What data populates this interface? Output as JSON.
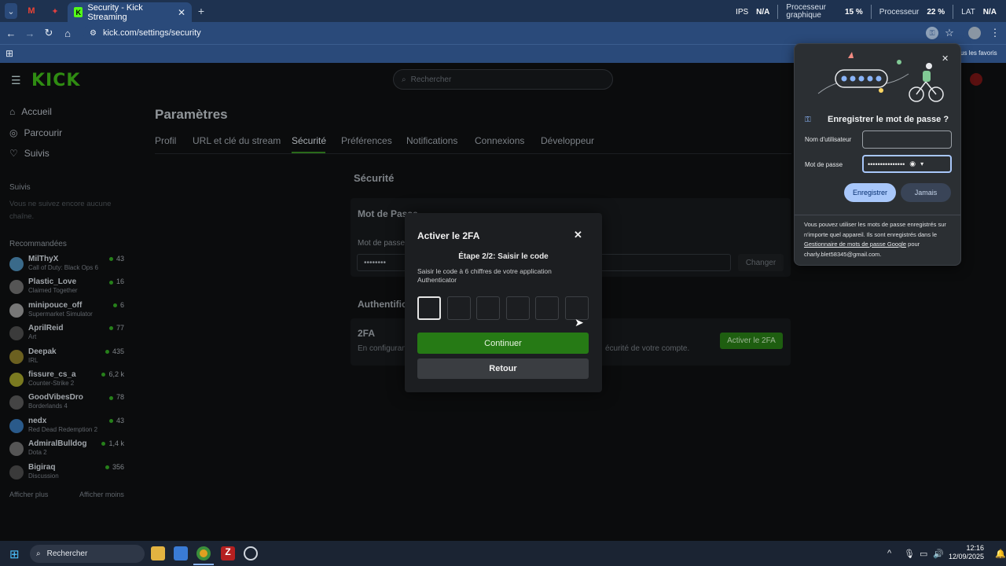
{
  "browser": {
    "tab_title": "Security - Kick Streaming",
    "new_tab": "+",
    "url": "kick.com/settings/security",
    "bookmarks_tail": "us les favoris"
  },
  "sysmon": {
    "ips_label": "IPS",
    "ips_value": "N/A",
    "gpu_label1": "Processeur",
    "gpu_label2": "graphique",
    "gpu_value": "15 %",
    "cpu_label": "Processeur",
    "cpu_value": "22 %",
    "lat_label": "LAT",
    "lat_value": "N/A"
  },
  "site": {
    "logo": "KICK",
    "search_placeholder": "Rechercher",
    "nav": [
      {
        "icon": "home-icon",
        "label": "Accueil"
      },
      {
        "icon": "compass-icon",
        "label": "Parcourir"
      },
      {
        "icon": "heart-icon",
        "label": "Suivis"
      }
    ],
    "following_title": "Suivis",
    "following_empty": "Vous ne suivez encore aucune chaîne.",
    "recommended_title": "Recommandées",
    "streams": [
      {
        "name": "MilThyX",
        "game": "Call of Duty: Black Ops 6",
        "viewers": "43",
        "color": "#3a6a8a"
      },
      {
        "name": "Plastic_Love",
        "game": "Claimed Together",
        "viewers": "16",
        "color": "#555"
      },
      {
        "name": "minipouce_off",
        "game": "Supermarket Simulator",
        "viewers": "6",
        "color": "#777"
      },
      {
        "name": "AprilReid",
        "game": "Art",
        "viewers": "77",
        "color": "#3b3b3b"
      },
      {
        "name": "Deepak",
        "game": "IRL",
        "viewers": "435",
        "color": "#6b6020"
      },
      {
        "name": "fissure_cs_a",
        "game": "Counter-Strike 2",
        "viewers": "6,2 k",
        "color": "#7a7a20"
      },
      {
        "name": "GoodVibesDro",
        "game": "Borderlands 4",
        "viewers": "78",
        "color": "#444"
      },
      {
        "name": "nedx",
        "game": "Red Dead Redemption 2",
        "viewers": "43",
        "color": "#2a5a8a"
      },
      {
        "name": "AdmiralBulldog",
        "game": "Dota 2",
        "viewers": "1,4 k",
        "color": "#555"
      },
      {
        "name": "Bigiraq",
        "game": "Discussion",
        "viewers": "356",
        "color": "#3a3a3a"
      }
    ],
    "show_more": "Afficher plus",
    "show_less": "Afficher moins"
  },
  "settings": {
    "title": "Paramètres",
    "tabs": [
      "Profil",
      "URL et clé du stream",
      "Sécurité",
      "Préférences",
      "Notifications",
      "Connexions",
      "Développeur"
    ],
    "section": "Sécurité",
    "password_card_title": "Mot de Passe",
    "password_label": "Mot de passe",
    "password_value": "••••••••",
    "change_button": "Changer",
    "auth_title": "Authentification",
    "twofa_label": "2FA",
    "twofa_desc_left": "En configurant",
    "twofa_desc_right": "écurité de votre compte.",
    "twofa_button": "Activer le 2FA"
  },
  "modal": {
    "title": "Activer le 2FA",
    "step": "Étape 2/2: Saisir le code",
    "description": "Saisir le code à 6 chiffres de votre application Authenticator",
    "continue": "Continuer",
    "back": "Retour"
  },
  "password_popup": {
    "title": "Enregistrer le mot de passe ?",
    "username_label": "Nom d'utilisateur",
    "password_label": "Mot de passe",
    "password_value": "•••••••••••••••",
    "save": "Enregistrer",
    "never": "Jamais",
    "footer_text": "Vous pouvez utiliser les mots de passe enregistrés sur n'importe quel appareil. Ils sont enregistrés dans le",
    "footer_link": "Gestionnaire de mots de passe Google",
    "footer_after": "pour",
    "footer_email": "charly.blet58345@gmail.com."
  },
  "taskbar": {
    "search": "Rechercher",
    "time": "12:16",
    "date": "12/09/2025"
  }
}
